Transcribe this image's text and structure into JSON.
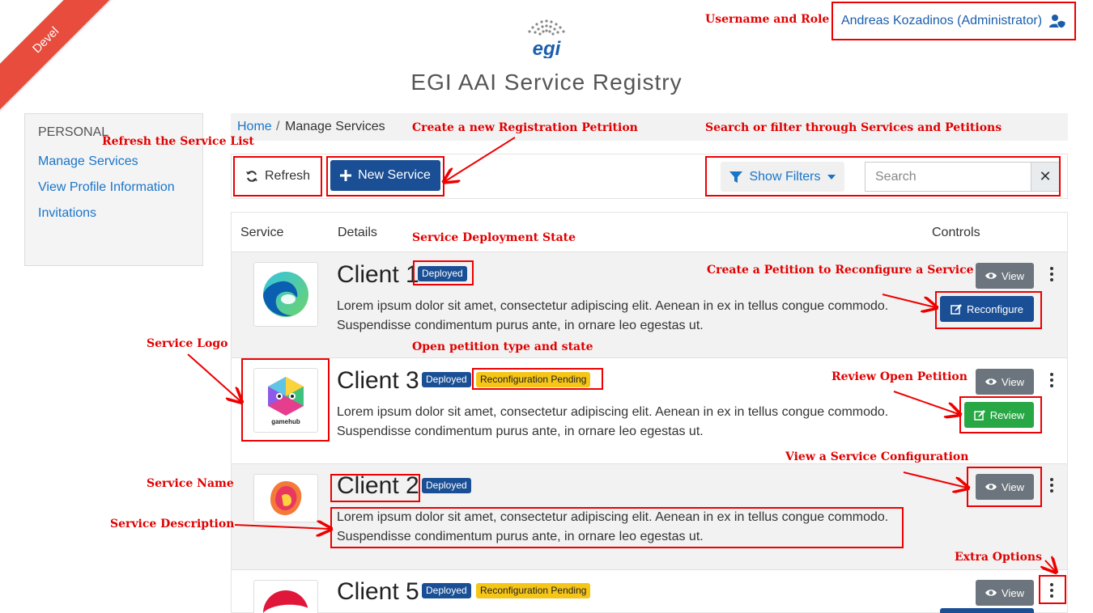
{
  "ribbon": {
    "label": "Devel"
  },
  "header": {
    "title": "EGI AAI Service Registry",
    "logo_text": "egi",
    "user": "Andreas Kozadinos (Administrator)",
    "user_icon": "user-shield-icon"
  },
  "sidebar": {
    "heading": "PERSONAL",
    "items": [
      {
        "label": "Manage Services"
      },
      {
        "label": "View Profile Information"
      },
      {
        "label": "Invitations"
      }
    ]
  },
  "breadcrumb": {
    "home": "Home",
    "separator": "/",
    "current": "Manage Services"
  },
  "toolbar": {
    "refresh_label": "Refresh",
    "new_service_label": "New Service",
    "show_filters_label": "Show Filters",
    "search_placeholder": "Search",
    "clear_symbol": "✕"
  },
  "table": {
    "headers": {
      "service": "Service",
      "details": "Details",
      "controls": "Controls"
    },
    "view_label": "View",
    "reconfigure_label": "Reconfigure",
    "review_label": "Review",
    "rows": [
      {
        "name": "Client 1",
        "badges": [
          "Deployed"
        ],
        "description_line1": "Lorem ipsum dolor sit amet, consectetur adipiscing elit. Aenean in ex in tellus congue commodo.",
        "description_line2": "Suspendisse condimentum purus ante, in ornare leo egestas ut.",
        "logo": "edge-logo"
      },
      {
        "name": "Client 3",
        "badges": [
          "Deployed",
          "Reconfiguration Pending"
        ],
        "description_line1": "Lorem ipsum dolor sit amet, consectetur adipiscing elit. Aenean in ex in tellus congue commodo.",
        "description_line2": "Suspendisse condimentum purus ante, in ornare leo egestas ut.",
        "logo": "gamehub-logo",
        "logo_text": "gamehub"
      },
      {
        "name": "Client 2",
        "badges": [
          "Deployed"
        ],
        "description_line1": "Lorem ipsum dolor sit amet, consectetur adipiscing elit. Aenean in ex in tellus congue commodo.",
        "description_line2": "Suspendisse condimentum purus ante, in ornare leo egestas ut.",
        "logo": "lion-logo"
      },
      {
        "name": "Client 5",
        "badges": [
          "Deployed",
          "Reconfiguration Pending"
        ],
        "logo": "pepsi-logo"
      }
    ]
  },
  "annotations": {
    "username_role": "Username and Role",
    "refresh": "Refresh the Service List",
    "new_petition": "Create a new Registration Petrition",
    "search_filter": "Search or filter through Services and Petitions",
    "deployment_state": "Service Deployment State",
    "reconfigure": "Create  a Petition to Reconfigure a  Service",
    "service_logo": "Service Logo",
    "open_petition": "Open petition type and state",
    "review": "Review Open Petition",
    "view_config": "View a Service Configuration",
    "service_name": "Service Name",
    "service_description": "Service Description",
    "extra_options": "Extra Options"
  },
  "colors": {
    "primary": "#1a4f95",
    "link": "#1a75c9",
    "success": "#28a745",
    "warning": "#f5c518",
    "annotation": "#e00000",
    "ribbon": "#e74c3c"
  }
}
